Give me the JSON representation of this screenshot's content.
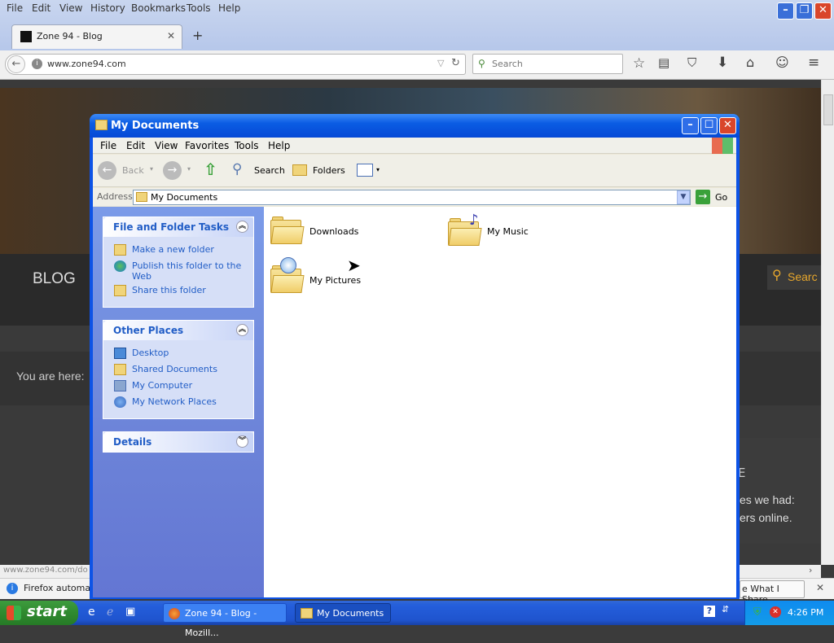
{
  "firefox": {
    "menu": [
      "File",
      "Edit",
      "View",
      "History",
      "Bookmarks",
      "Tools",
      "Help"
    ],
    "tab_title": "Zone 94 - Blog",
    "url": "www.zone94.com",
    "search_placeholder": "Search",
    "status_url": "www.zone94.com/do",
    "notification": "Firefox automatic",
    "notification_right": "e What I Share"
  },
  "website": {
    "nav_blog": "BLOG",
    "search_label": "Searc",
    "you_are_here": "You are here:",
    "snippet_line1": "es we had:",
    "snippet_line2": "ers online.",
    "snippet_mark": "E"
  },
  "explorer": {
    "title": "My Documents",
    "menu": [
      "File",
      "Edit",
      "View",
      "Favorites",
      "Tools",
      "Help"
    ],
    "toolbar": {
      "back": "Back",
      "search": "Search",
      "folders": "Folders"
    },
    "address_label": "Address",
    "address_value": "My Documents",
    "go_label": "Go",
    "tasks": {
      "title": "File and Folder Tasks",
      "items": [
        "Make a new folder",
        "Publish this folder to the Web",
        "Share this folder"
      ]
    },
    "other_places": {
      "title": "Other Places",
      "items": [
        "Desktop",
        "Shared Documents",
        "My Computer",
        "My Network Places"
      ]
    },
    "details": {
      "title": "Details"
    },
    "folders": [
      "Downloads",
      "My Music",
      "My Pictures"
    ]
  },
  "taskbar": {
    "start": "start",
    "buttons": [
      "Zone 94 - Blog - Mozill...",
      "My Documents"
    ],
    "clock": "4:26 PM"
  }
}
